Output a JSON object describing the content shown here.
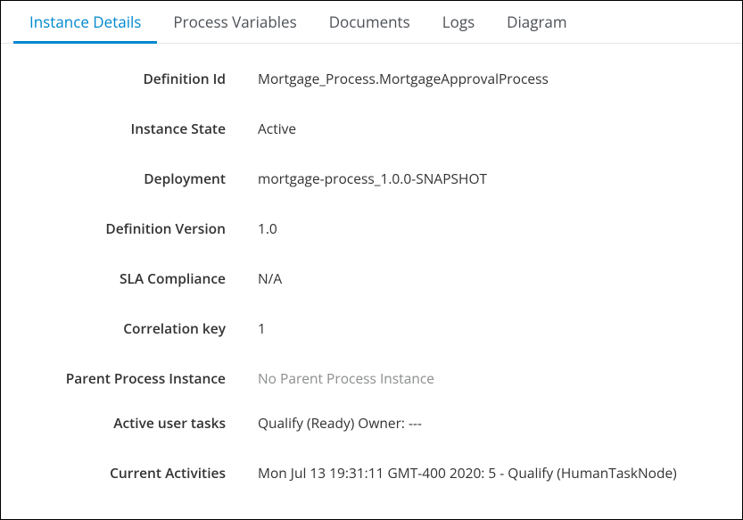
{
  "tabs": [
    {
      "label": "Instance Details",
      "active": true
    },
    {
      "label": "Process Variables",
      "active": false
    },
    {
      "label": "Documents",
      "active": false
    },
    {
      "label": "Logs",
      "active": false
    },
    {
      "label": "Diagram",
      "active": false
    }
  ],
  "details": {
    "definitionId": {
      "label": "Definition Id",
      "value": "Mortgage_Process.MortgageApprovalProcess"
    },
    "instanceState": {
      "label": "Instance State",
      "value": "Active"
    },
    "deployment": {
      "label": "Deployment",
      "value": "mortgage-process_1.0.0-SNAPSHOT"
    },
    "definitionVersion": {
      "label": "Definition Version",
      "value": "1.0"
    },
    "slaCompliance": {
      "label": "SLA Compliance",
      "value": "N/A"
    },
    "correlationKey": {
      "label": "Correlation key",
      "value": "1"
    },
    "parentProcessInstance": {
      "label": "Parent Process Instance",
      "value": "No Parent Process Instance"
    },
    "activeUserTasks": {
      "label": "Active user tasks",
      "value": "Qualify (Ready) Owner: ---"
    },
    "currentActivities": {
      "label": "Current Activities",
      "value": "Mon Jul 13 19:31:11 GMT-400 2020: 5 - Qualify (HumanTaskNode)"
    }
  }
}
